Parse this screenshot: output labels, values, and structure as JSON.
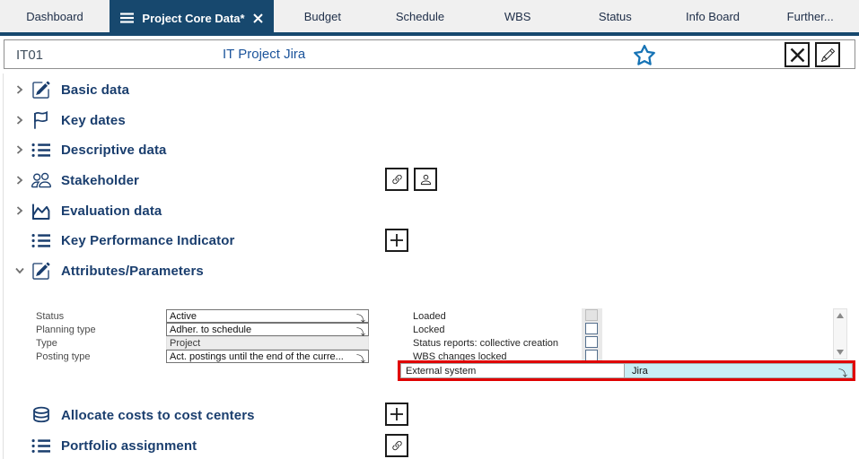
{
  "tabs": {
    "items": [
      {
        "label": "Dashboard"
      },
      {
        "label": "Project Core Data*"
      },
      {
        "label": "Budget"
      },
      {
        "label": "Schedule"
      },
      {
        "label": "WBS"
      },
      {
        "label": "Status"
      },
      {
        "label": "Info Board"
      },
      {
        "label": "Further..."
      }
    ]
  },
  "header": {
    "project_id": "IT01",
    "project_name": "IT Project Jira"
  },
  "sections": [
    {
      "label": "Basic data",
      "icon": "edit-icon",
      "chevron": "right"
    },
    {
      "label": "Key dates",
      "icon": "flag-icon",
      "chevron": "right"
    },
    {
      "label": "Descriptive data",
      "icon": "list-icon",
      "chevron": "right"
    },
    {
      "label": "Stakeholder",
      "icon": "group-icon",
      "chevron": "right",
      "actions": [
        "link-icon",
        "person-icon"
      ]
    },
    {
      "label": "Evaluation data",
      "icon": "area-chart-icon",
      "chevron": "right"
    },
    {
      "label": "Key Performance Indicator",
      "icon": "list-icon",
      "chevron": "none",
      "actions": [
        "plus-icon"
      ]
    },
    {
      "label": "Attributes/Parameters",
      "icon": "edit-icon",
      "chevron": "down"
    }
  ],
  "form": {
    "fields": [
      {
        "label": "Status",
        "value": "Active",
        "type": "select"
      },
      {
        "label": "Planning type",
        "value": "Adher. to schedule",
        "type": "select"
      },
      {
        "label": "Type",
        "value": "Project",
        "type": "readonly"
      },
      {
        "label": "Posting type",
        "value": "Act. postings until the end of the curre...",
        "type": "select"
      }
    ],
    "checkboxes": [
      {
        "label": "Loaded",
        "disabled": true,
        "checked": false
      },
      {
        "label": "Locked",
        "disabled": false,
        "checked": false
      },
      {
        "label": "Status reports: collective creation",
        "disabled": false,
        "checked": false
      },
      {
        "label": "WBS changes locked",
        "disabled": false,
        "checked": false
      }
    ],
    "external_system": {
      "label": "External system",
      "value": "Jira"
    }
  },
  "bottom_sections": [
    {
      "label": "Allocate costs to cost centers",
      "icon": "coins-icon",
      "action": "plus-icon"
    },
    {
      "label": "Portfolio assignment",
      "icon": "list-icon",
      "action": "link-icon"
    }
  ],
  "colors": {
    "accent_navy": "#17486e",
    "section_text": "#1a3e6e",
    "highlight_red": "#e00000",
    "external_field_bg": "#c9eef5",
    "star_blue": "#1673b5"
  }
}
